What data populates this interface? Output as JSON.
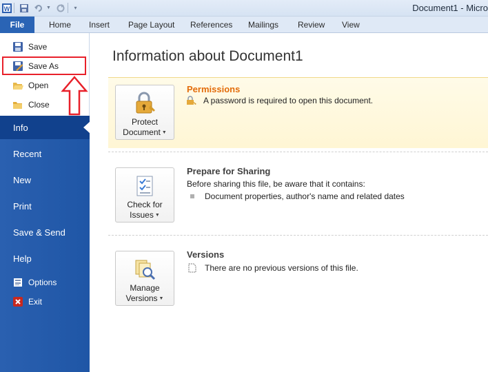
{
  "window": {
    "title": "Document1 - Micro"
  },
  "quick_access": {
    "app_icon": "word-icon",
    "save_icon": "save-icon",
    "undo_icon": "undo-icon",
    "redo_icon": "redo-icon",
    "customize_icon": "customize-icon"
  },
  "ribbon": {
    "file_tab": "File",
    "tabs": [
      "Home",
      "Insert",
      "Page Layout",
      "References",
      "Mailings",
      "Review",
      "View"
    ]
  },
  "backstage": {
    "commands": [
      {
        "label": "Save",
        "icon": "save-icon"
      },
      {
        "label": "Save As",
        "icon": "save-as-icon"
      },
      {
        "label": "Open",
        "icon": "open-folder-icon"
      },
      {
        "label": "Close",
        "icon": "close-folder-icon"
      }
    ],
    "nav": [
      "Info",
      "Recent",
      "New",
      "Print",
      "Save & Send",
      "Help"
    ],
    "active_nav": "Info",
    "small_items": [
      {
        "label": "Options",
        "icon": "options-icon"
      },
      {
        "label": "Exit",
        "icon": "exit-icon"
      }
    ]
  },
  "info": {
    "title": "Information about Document1",
    "permissions": {
      "button_line1": "Protect",
      "button_line2": "Document",
      "heading": "Permissions",
      "text": "A password is required to open this document."
    },
    "sharing": {
      "button_line1": "Check for",
      "button_line2": "Issues",
      "heading": "Prepare for Sharing",
      "text": "Before sharing this file, be aware that it contains:",
      "bullet": "Document properties, author's name and related dates"
    },
    "versions": {
      "button_line1": "Manage",
      "button_line2": "Versions",
      "heading": "Versions",
      "text": "There are no previous versions of this file."
    }
  },
  "colors": {
    "accent_blue": "#2a60b0",
    "active_nav": "#11418d",
    "permissions_heading": "#e36c0a",
    "annotation_red": "#e8202a"
  }
}
